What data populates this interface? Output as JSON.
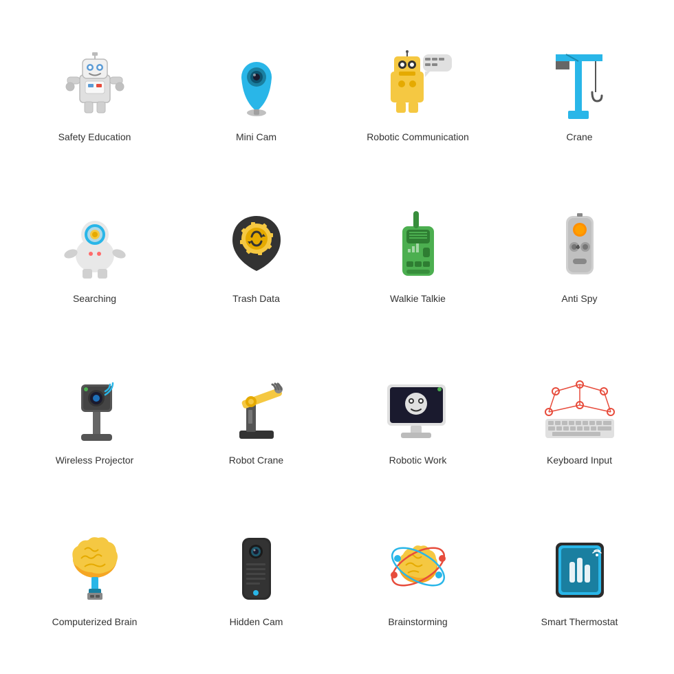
{
  "icons": [
    {
      "id": "safety-education",
      "label": "Safety Education",
      "row": 1,
      "col": 1
    },
    {
      "id": "mini-cam",
      "label": "Mini Cam",
      "row": 1,
      "col": 2
    },
    {
      "id": "robotic-communication",
      "label": "Robotic Communication",
      "row": 1,
      "col": 3
    },
    {
      "id": "crane",
      "label": "Crane",
      "row": 1,
      "col": 4
    },
    {
      "id": "searching",
      "label": "Searching",
      "row": 2,
      "col": 1
    },
    {
      "id": "trash-data",
      "label": "Trash Data",
      "row": 2,
      "col": 2
    },
    {
      "id": "walkie-talkie",
      "label": "Walkie Talkie",
      "row": 2,
      "col": 3
    },
    {
      "id": "anti-spy",
      "label": "Anti Spy",
      "row": 2,
      "col": 4
    },
    {
      "id": "wireless-projector",
      "label": "Wireless Projector",
      "row": 3,
      "col": 1
    },
    {
      "id": "robot-crane",
      "label": "Robot Crane",
      "row": 3,
      "col": 2
    },
    {
      "id": "robotic-work",
      "label": "Robotic Work",
      "row": 3,
      "col": 3
    },
    {
      "id": "keyboard-input",
      "label": "Keyboard Input",
      "row": 3,
      "col": 4
    },
    {
      "id": "computerized-brain",
      "label": "Computerized Brain",
      "row": 4,
      "col": 1
    },
    {
      "id": "hidden-cam",
      "label": "Hidden Cam",
      "row": 4,
      "col": 2
    },
    {
      "id": "brainstorming",
      "label": "Brainstorming",
      "row": 4,
      "col": 3
    },
    {
      "id": "smart-thermostat",
      "label": "Smart Thermostat",
      "row": 4,
      "col": 4
    }
  ]
}
